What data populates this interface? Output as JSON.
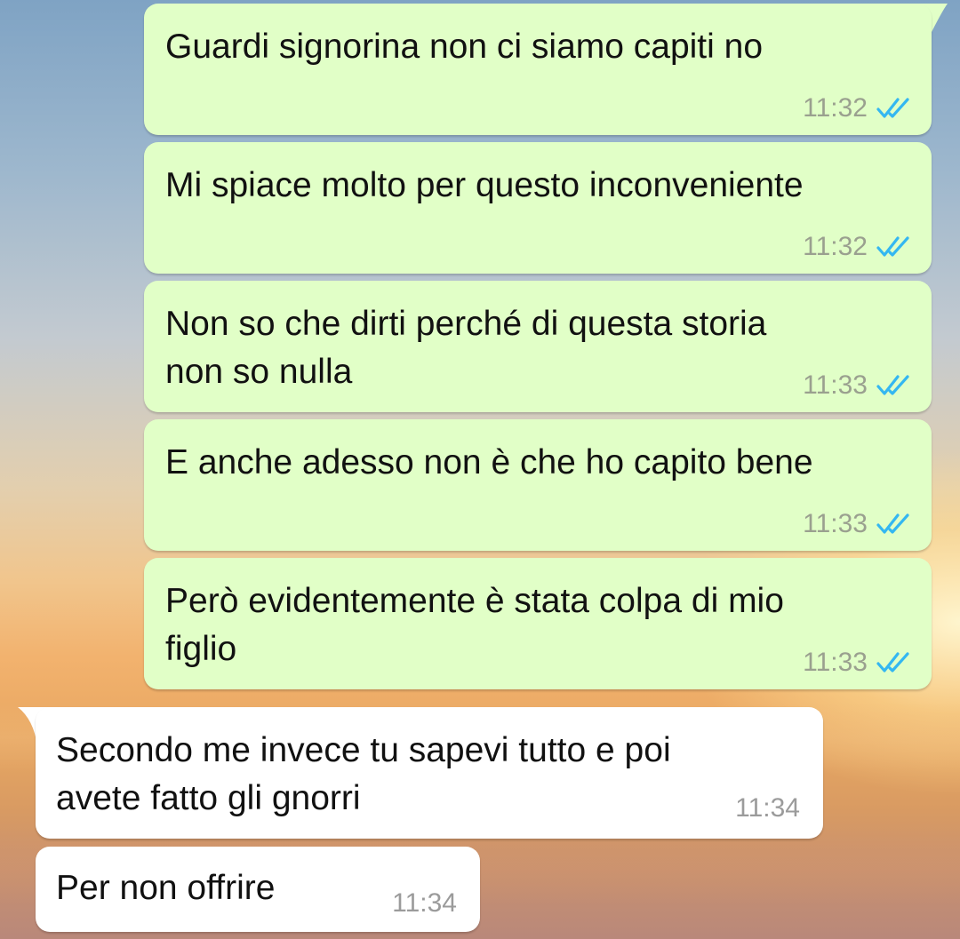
{
  "conversation": {
    "messages": [
      {
        "direction": "outgoing",
        "text": "Guardi signorina non ci siamo capiti no",
        "time": "11:32",
        "status": "read"
      },
      {
        "direction": "outgoing",
        "text": "Mi spiace molto per questo inconveniente",
        "time": "11:32",
        "status": "read"
      },
      {
        "direction": "outgoing",
        "text": "Non so che dirti perché di questa storia\nnon so nulla",
        "time": "11:33",
        "status": "read"
      },
      {
        "direction": "outgoing",
        "text": "E anche adesso non è che ho capito bene",
        "time": "11:33",
        "status": "read"
      },
      {
        "direction": "outgoing",
        "text": "Però evidentemente è stata colpa di mio\nfiglio",
        "time": "11:33",
        "status": "read"
      },
      {
        "direction": "incoming",
        "text": "Secondo me invece tu sapevi tutto e poi\navete fatto gli gnorri",
        "time": "11:34"
      },
      {
        "direction": "incoming",
        "text": "Per non offrire",
        "time": "11:34"
      }
    ]
  },
  "colors": {
    "outgoing_bubble": "#e1ffc7",
    "incoming_bubble": "#ffffff",
    "read_ticks": "#34b7f1",
    "timestamp": "#9aa08f"
  },
  "icons": {
    "read_status": "double-check-icon"
  }
}
